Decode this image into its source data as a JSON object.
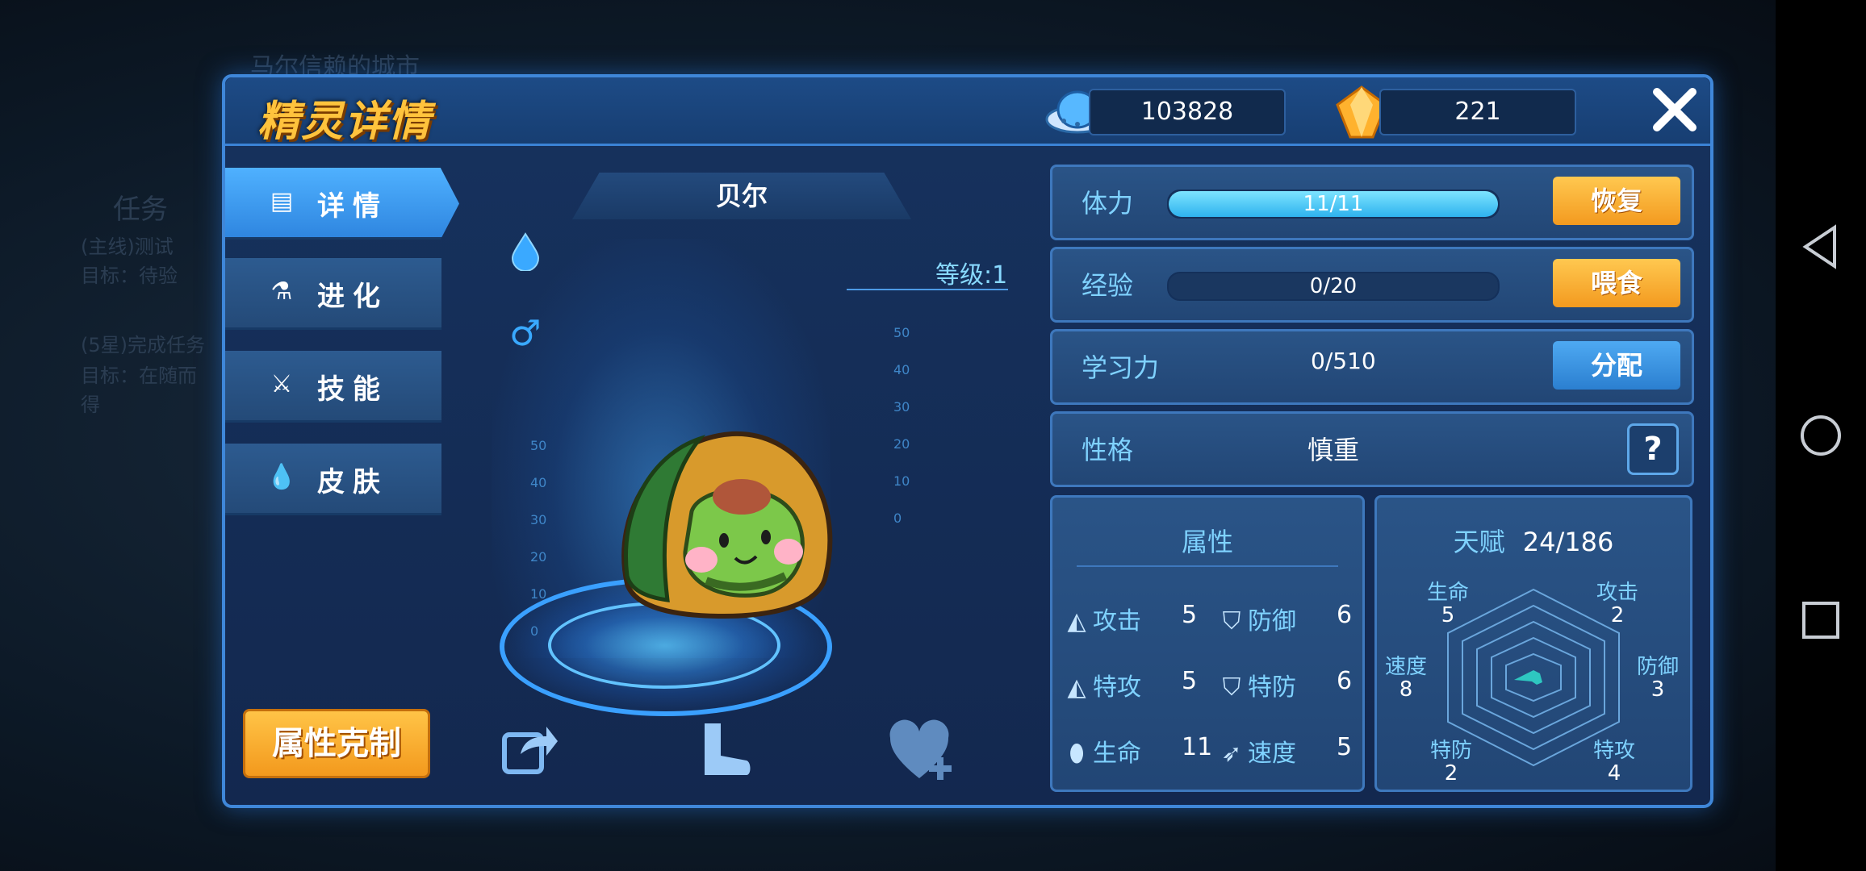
{
  "background": {
    "text_lines": [
      "马尔信赖的城市",
      "任务",
      "(主线)测试",
      "目标：待验",
      "(5星)完成任务",
      "目标：在随而",
      "得"
    ]
  },
  "header": {
    "title": "精灵详情",
    "coins": "103828",
    "diamonds": "221",
    "close_icon": "close-icon"
  },
  "tabs": [
    {
      "label": "详情",
      "icon": "details-icon",
      "active": true
    },
    {
      "label": "进化",
      "icon": "flask-icon",
      "active": false
    },
    {
      "label": "技能",
      "icon": "sword-icon",
      "active": false
    },
    {
      "label": "皮肤",
      "icon": "droplet-icon",
      "active": false
    }
  ],
  "attr_button": "属性克制",
  "pet": {
    "name": "贝尔",
    "level": "等级:1",
    "element_icon": "water-drop-icon",
    "gender": "♂"
  },
  "scale_left": [
    "50",
    "40",
    "30",
    "20",
    "10",
    "0"
  ],
  "scale_right": [
    "50",
    "40",
    "30",
    "20",
    "10",
    "0"
  ],
  "bottom_icons": [
    "share-icon",
    "boot-icon",
    "heart-plus-icon"
  ],
  "info": {
    "stamina": {
      "label": "体力",
      "value": "11/11",
      "fill": 1.0,
      "button": "恢复"
    },
    "exp": {
      "label": "经验",
      "value": "0/20",
      "fill": 0.0,
      "button": "喂食"
    },
    "learn": {
      "label": "学习力",
      "value": "0/510",
      "button": "分配"
    },
    "nature": {
      "label": "性格",
      "value": "慎重",
      "help": "?"
    }
  },
  "attributes": {
    "title": "属性",
    "stats": [
      {
        "name": "攻击",
        "value": "5"
      },
      {
        "name": "防御",
        "value": "6"
      },
      {
        "name": "特攻",
        "value": "5"
      },
      {
        "name": "特防",
        "value": "6"
      },
      {
        "name": "生命",
        "value": "11"
      },
      {
        "name": "速度",
        "value": "5"
      }
    ]
  },
  "talent": {
    "title": "天赋",
    "total": "24/186",
    "axes": [
      {
        "name": "生命",
        "value": "5"
      },
      {
        "name": "攻击",
        "value": "2"
      },
      {
        "name": "防御",
        "value": "3"
      },
      {
        "name": "特攻",
        "value": "4"
      },
      {
        "name": "特防",
        "value": "2"
      },
      {
        "name": "速度",
        "value": "8"
      }
    ]
  },
  "colors": {
    "accent": "#7fd2ff",
    "gold": "#ffc33d",
    "orange": "#f39a1f",
    "panel": "#16325e"
  }
}
